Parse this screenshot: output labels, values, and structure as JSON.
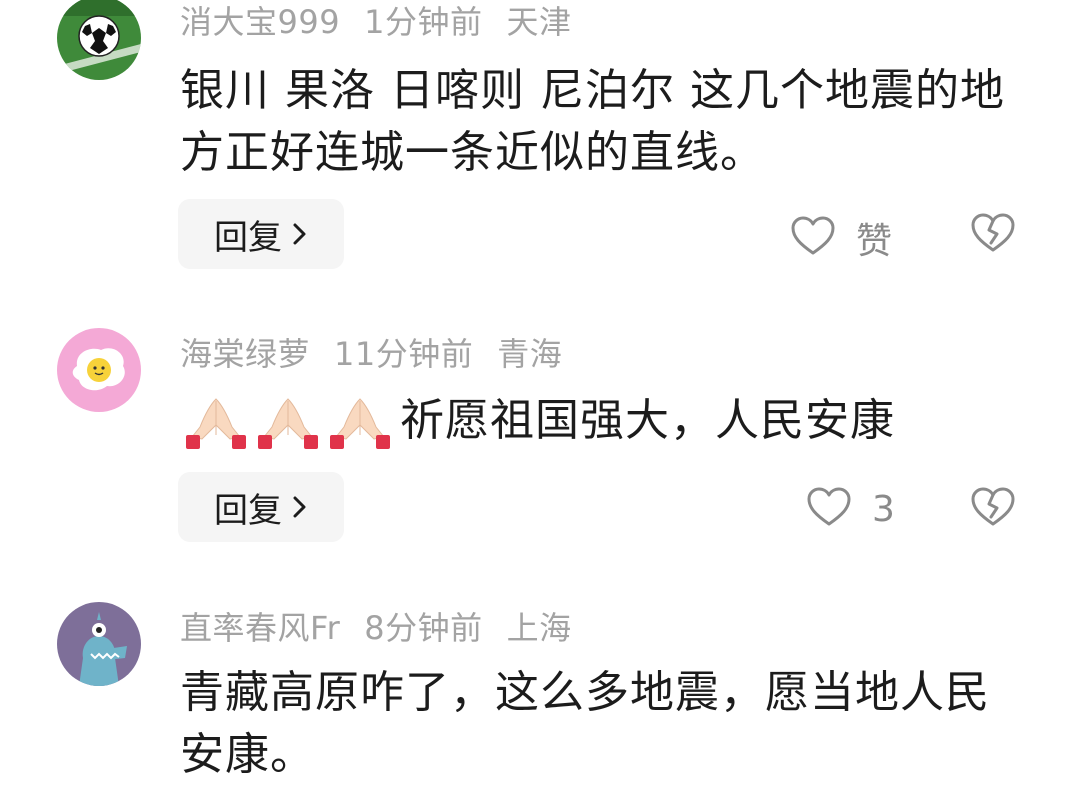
{
  "comments": [
    {
      "username": "消大宝999",
      "time": "1分钟前",
      "location": "天津",
      "text": "银川 果洛 日喀则 尼泊尔 这几个地震的地方正好连城一条近似的直线。",
      "reply_label": "回复",
      "like_label": "赞",
      "avatar_icon": "soccer-ball-avatar"
    },
    {
      "username": "海棠绿萝",
      "time": "11分钟前",
      "location": "青海",
      "emoji_prefix": [
        "praying-hands",
        "praying-hands",
        "praying-hands"
      ],
      "text": "祈愿祖国强大，人民安康",
      "reply_label": "回复",
      "like_count": "3",
      "avatar_icon": "fried-egg-avatar"
    },
    {
      "username": "直率春风Fr",
      "time": "8分钟前",
      "location": "上海",
      "text": "青藏高原咋了，这么多地震，愿当地人民安康。",
      "avatar_icon": "blue-monster-avatar"
    }
  ],
  "colors": {
    "meta_gray": "#a3a3a3",
    "text_dark": "#1c1c1c",
    "button_bg": "#f5f5f5",
    "icon_gray": "#8a8a8a"
  }
}
